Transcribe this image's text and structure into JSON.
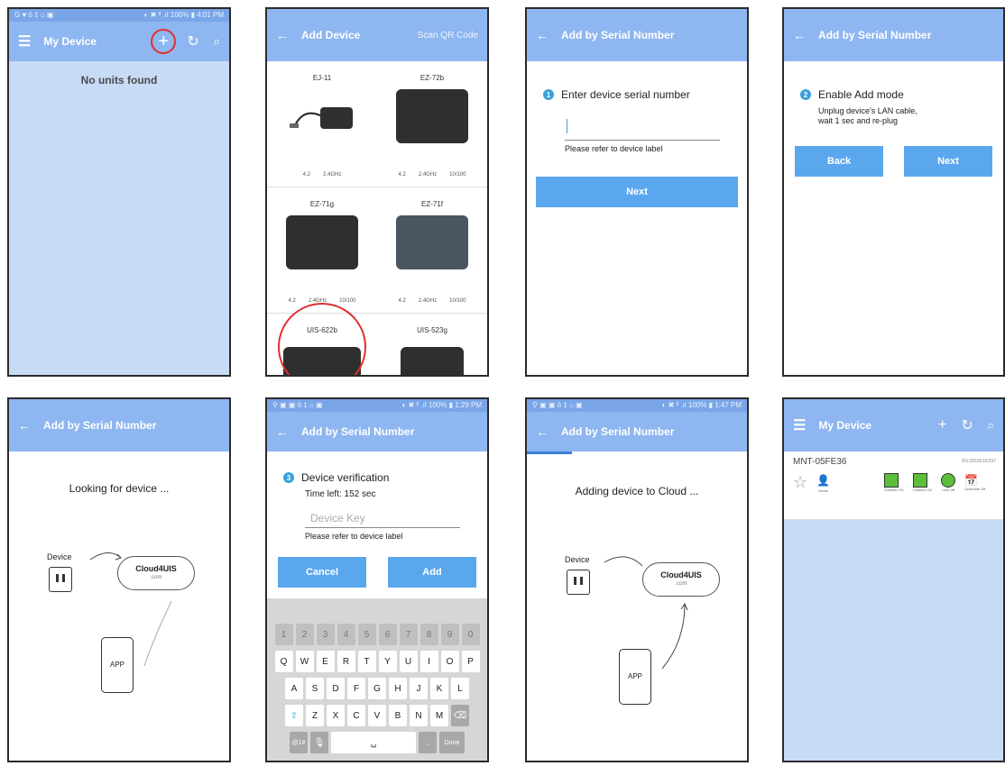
{
  "screen1": {
    "status_left": "G ♥ ö ‡ ⌂ ▣",
    "status_right": "◐ ✖ ᴵᴵ .ıl 100% ▮ 4:01 PM",
    "menu_icon": "hamburger-icon",
    "title": "My Device",
    "add_icon": "plus-icon",
    "refresh_icon": "refresh-icon",
    "search_icon": "search-icon",
    "empty_text": "No units found"
  },
  "screen2": {
    "title": "Add Device",
    "scan_link": "Scan QR Code",
    "devices": [
      {
        "name": "EJ-11",
        "specs": [
          "4.2",
          "2.4GHz"
        ]
      },
      {
        "name": "EZ-72b",
        "specs": [
          "4.2",
          "2.4GHz",
          "10/100"
        ]
      },
      {
        "name": "EZ-71g",
        "specs": [
          "4.2",
          "2.4GHz",
          "10/100"
        ]
      },
      {
        "name": "EZ-71f",
        "specs": [
          "4.2",
          "2.4GHz",
          "10/100"
        ]
      },
      {
        "name": "UIS-622b",
        "specs": []
      },
      {
        "name": "UIS-523g",
        "specs": []
      }
    ]
  },
  "screen3": {
    "title": "Add by Serial Number",
    "step_number": "1",
    "step_text": "Enter device serial number",
    "hint": "Please refer to device label",
    "next_label": "Next"
  },
  "screen4": {
    "title": "Add by Serial Number",
    "step_number": "2",
    "step_text": "Enable Add mode",
    "instructions_1": "Unplug device's LAN cable,",
    "instructions_2": "wait 1 sec and re-plug",
    "back_label": "Back",
    "next_label": "Next"
  },
  "screen5": {
    "title": "Add by Serial Number",
    "message": "Looking for device ...",
    "device_label": "Device",
    "cloud_label": "Cloud4UIS",
    "cloud_sub": ".com",
    "app_label": "APP"
  },
  "screen6": {
    "status_right": "◐ ✖ ᴵᴵ .ıl 100% ▮ 1:29 PM",
    "title": "Add by Serial Number",
    "step_number": "3",
    "step_text": "Device verification",
    "time_left": "Time left: 152 sec",
    "placeholder": "Device Key",
    "hint": "Please refer to device label",
    "cancel_label": "Cancel",
    "add_label": "Add",
    "keyboard_rows": [
      [
        "1",
        "2",
        "3",
        "4",
        "5",
        "6",
        "7",
        "8",
        "9",
        "0"
      ],
      [
        "Q",
        "W",
        "E",
        "R",
        "T",
        "Y",
        "U",
        "I",
        "O",
        "P"
      ],
      [
        "A",
        "S",
        "D",
        "F",
        "G",
        "H",
        "J",
        "K",
        "L"
      ],
      [
        "Z",
        "X",
        "C",
        "V",
        "B",
        "N",
        "M"
      ]
    ],
    "key_sym": "@1#",
    "key_done": "Done"
  },
  "screen7": {
    "status_right": "◐ ✖ ᴵᴵ .ıl 100% ▮ 1:47 PM",
    "title": "Add by Serial Number",
    "message": "Adding device to Cloud ...",
    "device_label": "Device",
    "cloud_label": "Cloud4UIS",
    "cloud_sub": ".com",
    "app_label": "APP"
  },
  "screen8": {
    "title": "My Device",
    "device_name": "MNT-05FE36",
    "serial": "SN:2801E16/297",
    "icon_labels": [
      "Owner",
      "Outlet#1 On",
      "Outlet#2 On",
      "Link Off",
      "Schedule Off"
    ]
  }
}
